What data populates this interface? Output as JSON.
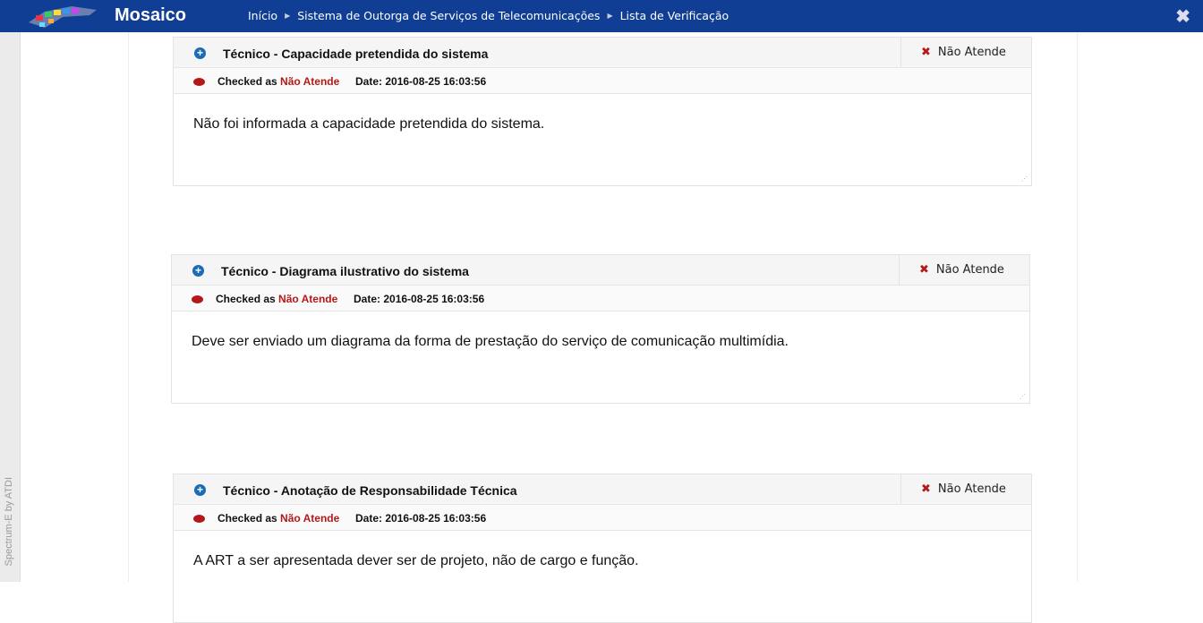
{
  "header": {
    "brand": "Mosaico",
    "breadcrumbs": [
      "Início",
      "Sistema de Outorga de Serviços de Telecomunicações",
      "Lista de Verificação"
    ],
    "close_icon": "close-icon"
  },
  "sidebar": {
    "credit": "Spectrum-E by ATDI"
  },
  "items": [
    {
      "title": "Técnico - Capacidade pretendida do sistema",
      "status": "Não Atende",
      "checked_prefix": "Checked as",
      "checked_value": "Não Atende",
      "date_label": "Date:",
      "date": "2016-08-25 16:03:56",
      "comment": "Não foi informada a capacidade pretendida do sistema."
    },
    {
      "title": "Técnico - Diagrama ilustrativo do sistema",
      "status": "Não Atende",
      "checked_prefix": "Checked as",
      "checked_value": "Não Atende",
      "date_label": "Date:",
      "date": "2016-08-25 16:03:56",
      "comment": "Deve ser enviado um diagrama da forma de prestação do serviço de comunicação multimídia."
    },
    {
      "title": "Técnico - Anotação de Responsabilidade Técnica",
      "status": "Não Atende",
      "checked_prefix": "Checked as",
      "checked_value": "Não Atende",
      "date_label": "Date:",
      "date": "2016-08-25 16:03:56",
      "comment": "A ART a ser apresentada dever ser de projeto, não de cargo e função."
    }
  ]
}
